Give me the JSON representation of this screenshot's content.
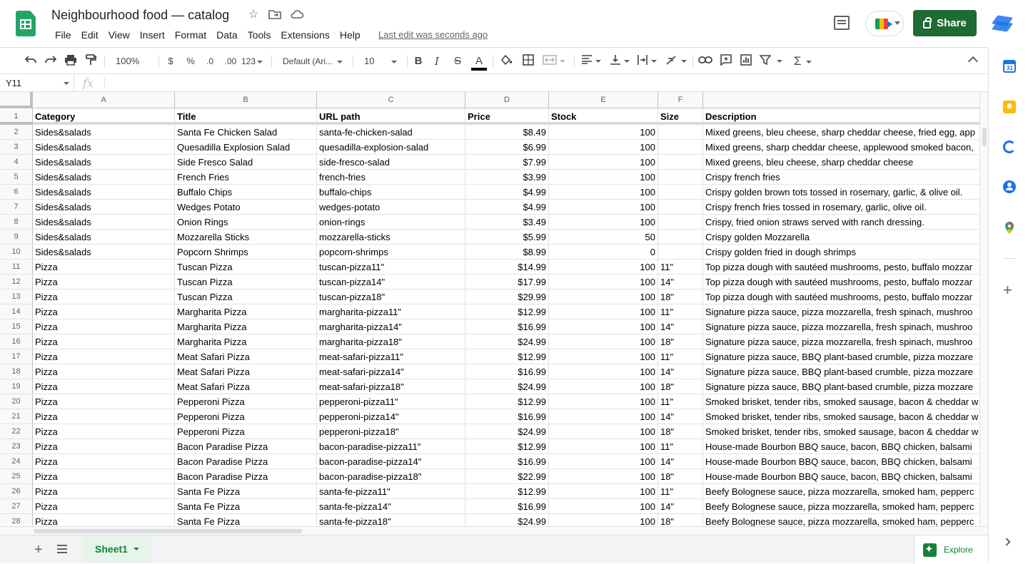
{
  "doc": {
    "title": "Neighbourhood food — catalog",
    "last_edit": "Last edit was seconds ago",
    "share_label": "Share"
  },
  "menu": [
    "File",
    "Edit",
    "View",
    "Insert",
    "Format",
    "Data",
    "Tools",
    "Extensions",
    "Help"
  ],
  "toolbar": {
    "zoom": "100%",
    "currency": "$",
    "percent": "%",
    "decrease_decimals": ".0",
    "increase_decimals": ".00",
    "more_formats": "123",
    "font_family": "Default (Ari...",
    "font_size": "10",
    "bold": "B",
    "italic": "I",
    "strike": "S",
    "text_color": "A"
  },
  "formula_bar": {
    "name_box": "Y11",
    "fx": "fx"
  },
  "columns": [
    "A",
    "B",
    "C",
    "D",
    "E",
    "F"
  ],
  "header_row": [
    "Category",
    "Title",
    "URL path",
    "Price",
    "Stock",
    "Size",
    "Description"
  ],
  "rows": [
    [
      "Sides&salads",
      "Santa Fe Chicken Salad",
      "santa-fe-chicken-salad",
      "$8.49",
      "100",
      "",
      "Mixed greens, bleu cheese, sharp cheddar cheese, fried egg, app"
    ],
    [
      "Sides&salads",
      "Quesadilla Explosion Salad",
      "quesadilla-explosion-salad",
      "$6.99",
      "100",
      "",
      "Mixed greens, sharp cheddar cheese, applewood smoked bacon,"
    ],
    [
      "Sides&salads",
      "Side Fresco Salad",
      "side-fresco-salad",
      "$7.99",
      "100",
      "",
      "Mixed greens, bleu cheese, sharp cheddar cheese"
    ],
    [
      "Sides&salads",
      "French Fries",
      "french-fries",
      "$3.99",
      "100",
      "",
      "Crispy french fries"
    ],
    [
      "Sides&salads",
      "Buffalo Chips",
      "buffalo-chips",
      "$4.99",
      "100",
      "",
      "Crispy golden brown tots tossed in rosemary, garlic, & olive oil."
    ],
    [
      "Sides&salads",
      "Wedges Potato",
      "wedges-potato",
      "$4.99",
      "100",
      "",
      "Crispy french fries tossed in rosemary, garlic, olive oil."
    ],
    [
      "Sides&salads",
      "Onion Rings",
      "onion-rings",
      "$3.49",
      "100",
      "",
      "Crispy, fried onion straws served with ranch dressing."
    ],
    [
      "Sides&salads",
      "Mozzarella Sticks",
      "mozzarella-sticks",
      "$5.99",
      "50",
      "",
      "Crispy golden Mozzarella"
    ],
    [
      "Sides&salads",
      "Popcorn Shrimps",
      "popcorn-shrimps",
      "$8.99",
      "0",
      "",
      "Crispy golden fried  in dough shrimps"
    ],
    [
      "Pizza",
      "Tuscan Pizza",
      "tuscan-pizza11\"",
      "$14.99",
      "100",
      "11\"",
      "Top pizza dough with sautéed mushrooms, pesto, buffalo mozzar"
    ],
    [
      "Pizza",
      "Tuscan Pizza",
      "tuscan-pizza14\"",
      "$17.99",
      "100",
      "14\"",
      "Top pizza dough with sautéed mushrooms, pesto, buffalo mozzar"
    ],
    [
      "Pizza",
      "Tuscan Pizza",
      "tuscan-pizza18\"",
      "$29.99",
      "100",
      "18\"",
      "Top pizza dough with sautéed mushrooms, pesto, buffalo mozzar"
    ],
    [
      "Pizza",
      "Margharita Pizza",
      "margharita-pizza11\"",
      "$12.99",
      "100",
      "11\"",
      "Signature pizza sauce, pizza mozzarella, fresh spinach, mushroo"
    ],
    [
      "Pizza",
      "Margharita Pizza",
      "margharita-pizza14\"",
      "$16.99",
      "100",
      "14\"",
      "Signature pizza sauce, pizza mozzarella, fresh spinach, mushroo"
    ],
    [
      "Pizza",
      "Margharita Pizza",
      "margharita-pizza18\"",
      "$24.99",
      "100",
      "18\"",
      "Signature pizza sauce, pizza mozzarella, fresh spinach, mushroo"
    ],
    [
      "Pizza",
      "Meat Safari Pizza",
      "meat-safari-pizza11\"",
      "$12.99",
      "100",
      "11\"",
      "Signature pizza sauce, BBQ plant-based crumble, pizza mozzare"
    ],
    [
      "Pizza",
      "Meat Safari Pizza",
      "meat-safari-pizza14\"",
      "$16.99",
      "100",
      "14\"",
      "Signature pizza sauce, BBQ plant-based crumble, pizza mozzare"
    ],
    [
      "Pizza",
      "Meat Safari Pizza",
      "meat-safari-pizza18\"",
      "$24.99",
      "100",
      "18\"",
      "Signature pizza sauce, BBQ plant-based crumble, pizza mozzare"
    ],
    [
      "Pizza",
      "Pepperoni Pizza",
      "pepperoni-pizza11\"",
      "$12.99",
      "100",
      "11\"",
      "Smoked brisket, tender ribs, smoked sausage, bacon & cheddar w"
    ],
    [
      "Pizza",
      "Pepperoni Pizza",
      "pepperoni-pizza14\"",
      "$16.99",
      "100",
      "14\"",
      "Smoked brisket, tender ribs, smoked sausage, bacon & cheddar w"
    ],
    [
      "Pizza",
      "Pepperoni Pizza",
      "pepperoni-pizza18\"",
      "$24.99",
      "100",
      "18\"",
      "Smoked brisket, tender ribs, smoked sausage, bacon & cheddar w"
    ],
    [
      "Pizza",
      "Bacon Paradise Pizza",
      "bacon-paradise-pizza11\"",
      "$12.99",
      "100",
      "11\"",
      "House-made Bourbon BBQ sauce, bacon, BBQ chicken, balsami"
    ],
    [
      "Pizza",
      "Bacon Paradise Pizza",
      "bacon-paradise-pizza14\"",
      "$16.99",
      "100",
      "14\"",
      "House-made Bourbon BBQ sauce, bacon, BBQ chicken, balsami"
    ],
    [
      "Pizza",
      "Bacon Paradise Pizza",
      "bacon-paradise-pizza18\"",
      "$22.99",
      "100",
      "18\"",
      "House-made Bourbon BBQ sauce, bacon, BBQ chicken, balsami"
    ],
    [
      "Pizza",
      "Santa Fe Pizza",
      "santa-fe-pizza11\"",
      "$12.99",
      "100",
      "11\"",
      "Beefy Bolognese sauce, pizza mozzarella, smoked ham, pepperc"
    ],
    [
      "Pizza",
      "Santa Fe Pizza",
      "santa-fe-pizza14\"",
      "$16.99",
      "100",
      "14\"",
      "Beefy Bolognese sauce, pizza mozzarella, smoked ham, pepperc"
    ],
    [
      "Pizza",
      "Santa Fe Pizza",
      "santa-fe-pizza18\"",
      "$24.99",
      "100",
      "18\"",
      "Beefy Bolognese sauce, pizza mozzarella, smoked ham, pepperc"
    ]
  ],
  "sheets": {
    "active": "Sheet1",
    "explore_label": "Explore"
  },
  "colors": {
    "accent": "#188038",
    "share": "#1e6b34",
    "logo": "#23a566"
  }
}
